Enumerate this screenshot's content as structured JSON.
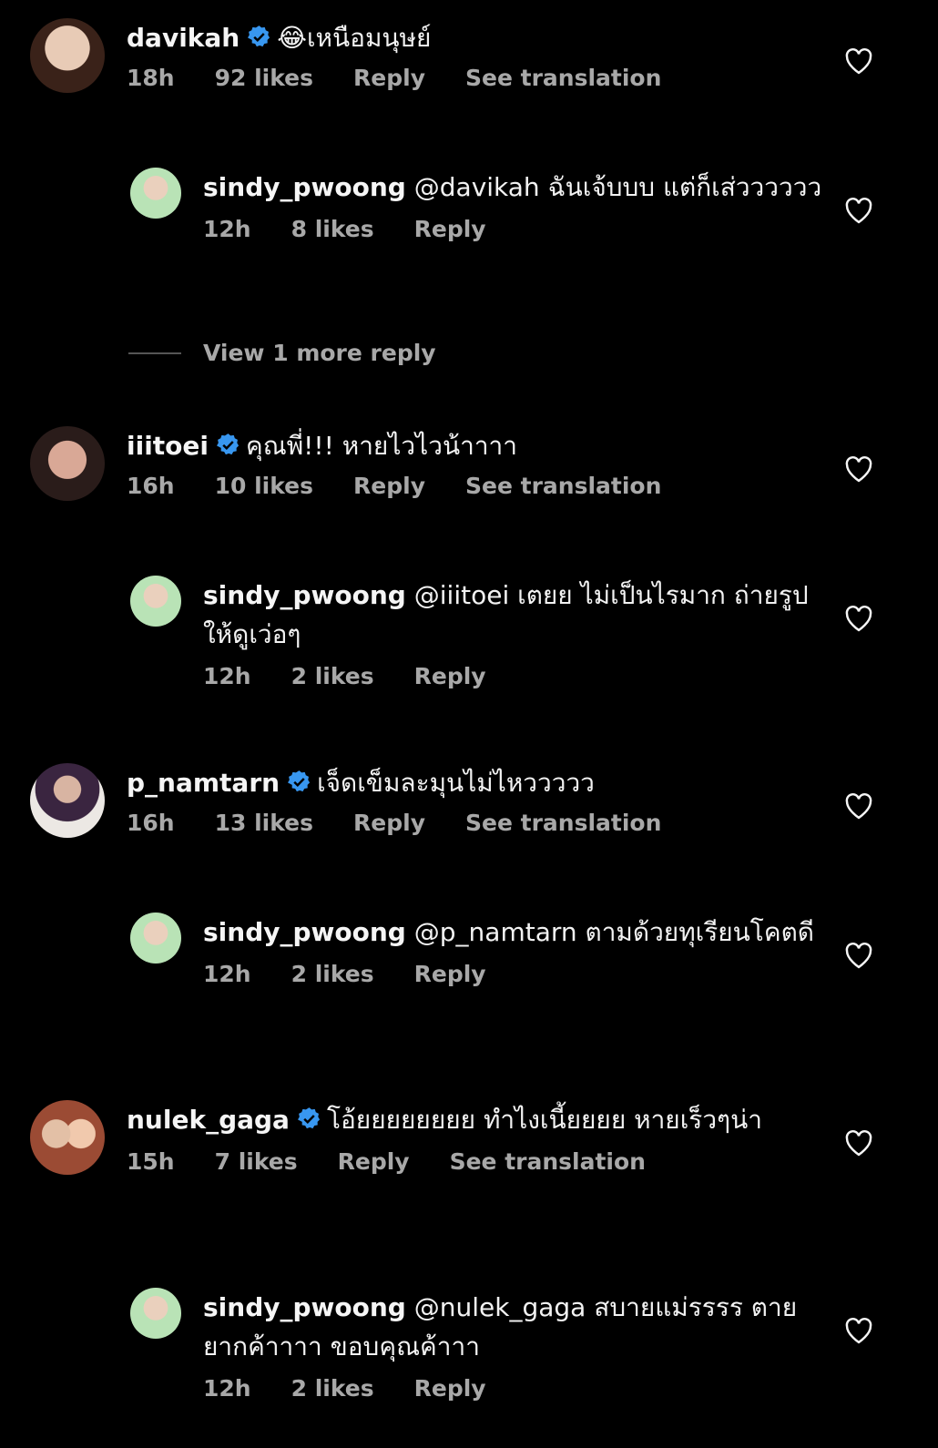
{
  "comments": [
    {
      "user": "davikah",
      "text": "😂เหนือมนุษย์",
      "time": "18h",
      "likes": "92 likes",
      "reply": "Reply",
      "translate": "See translation",
      "avatar_colors": [
        "#d9b9a5",
        "#4a2c22"
      ]
    },
    {
      "user": "sindy_pwoong",
      "text": "@davikah ฉันเจ้บบบ แต่ก็เส่วววววว",
      "time": "12h",
      "likes": "8 likes",
      "reply": "Reply",
      "avatar_colors": [
        "#c7e8c4",
        "#e8c9b5"
      ]
    },
    {
      "view_more": "View 1 more reply"
    },
    {
      "user": "iiitoei",
      "text": "คุณพี่!!! หายไวไวน้าาาา",
      "time": "16h",
      "likes": "10 likes",
      "reply": "Reply",
      "translate": "See translation",
      "avatar_colors": [
        "#3a2b28",
        "#c79b87"
      ]
    },
    {
      "user": "sindy_pwoong",
      "text": "@iiitoei เตยย ไม่เป็นไรมาก ถ่ายรูปให้ดูเว่อๆ",
      "time": "12h",
      "likes": "2 likes",
      "reply": "Reply",
      "avatar_colors": [
        "#c7e8c4",
        "#e8c9b5"
      ]
    },
    {
      "user": "p_namtarn",
      "text": "เจ็ดเข็มละมุนไม่ไหววววว",
      "time": "16h",
      "likes": "13 likes",
      "reply": "Reply",
      "translate": "See translation",
      "avatar_colors": [
        "#e7e3df",
        "#4b2f58"
      ]
    },
    {
      "user": "sindy_pwoong",
      "text": "@p_namtarn ตามด้วยทุเรียนโคตดี",
      "time": "12h",
      "likes": "2 likes",
      "reply": "Reply",
      "avatar_colors": [
        "#c7e8c4",
        "#e8c9b5"
      ]
    },
    {
      "user": "nulek_gaga",
      "text": "โอ้ยยยยยยยย  ทำไงเนี้ยยยย  หายเร็วๆน่า",
      "time": "15h",
      "likes": "7 likes",
      "reply": "Reply",
      "translate": "See translation",
      "avatar_colors": [
        "#e8b89a",
        "#a4553a"
      ]
    },
    {
      "user": "sindy_pwoong",
      "text": "@nulek_gaga สบายแม่รรรร ตายยากค้าาาา ขอบคุณค้าาา",
      "time": "12h",
      "likes": "2 likes",
      "reply": "Reply",
      "avatar_colors": [
        "#c7e8c4",
        "#e8c9b5"
      ]
    }
  ],
  "colors": {
    "background": "#000000",
    "verified": "#3897f0",
    "meta_text": "#a8a8a8"
  }
}
